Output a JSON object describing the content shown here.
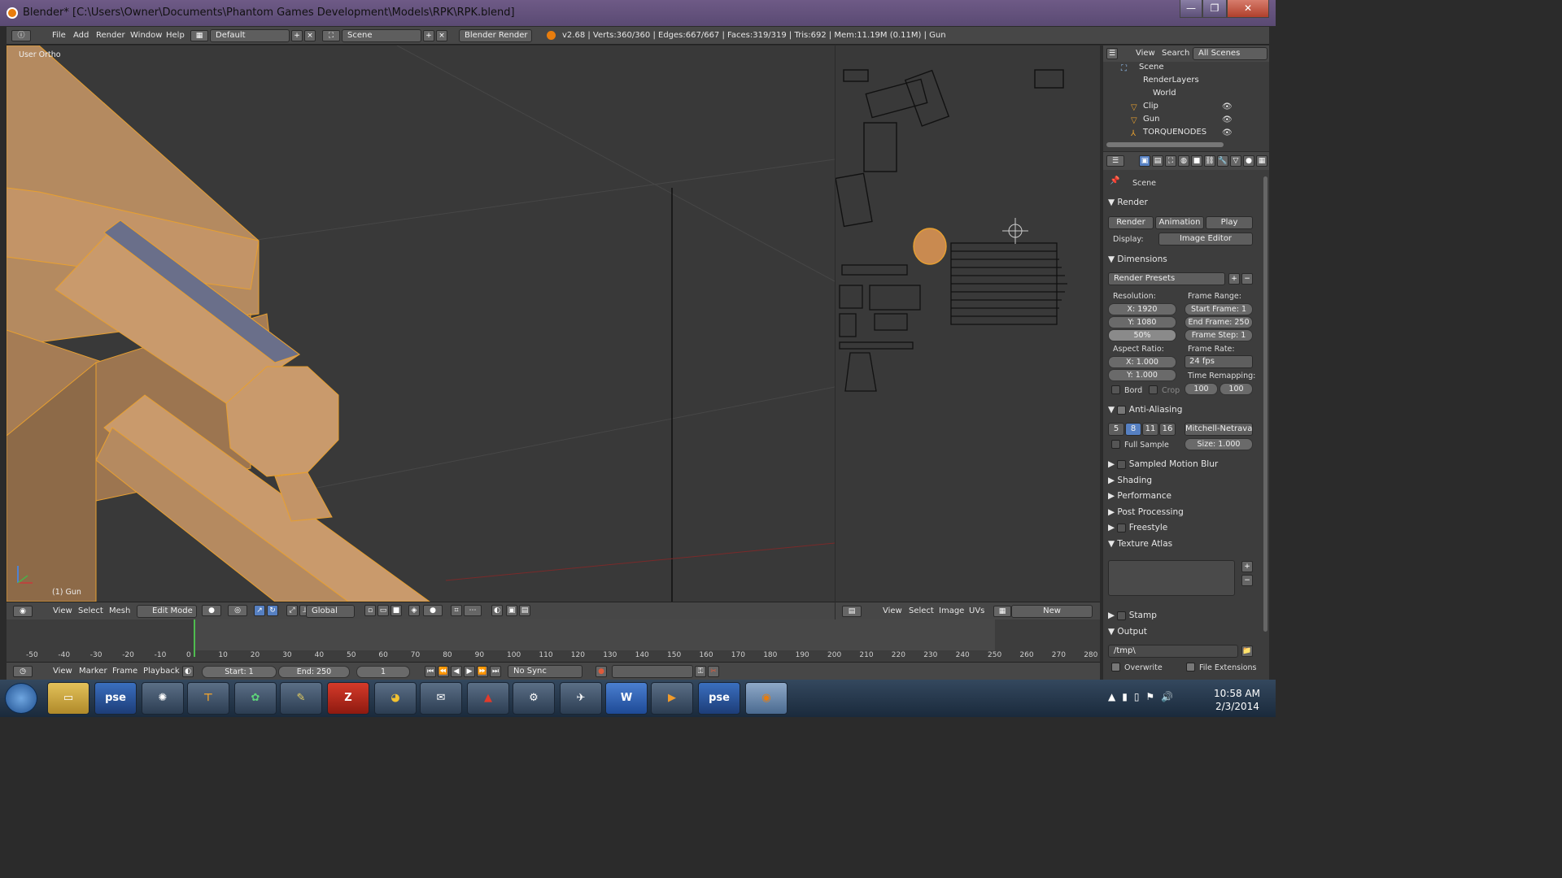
{
  "window": {
    "title": "Blender* [C:\\Users\\Owner\\Documents\\Phantom Games Development\\Models\\RPK\\RPK.blend]",
    "controls": [
      "—",
      "❐",
      "✕"
    ]
  },
  "menu": [
    "File",
    "Add",
    "Render",
    "Window",
    "Help"
  ],
  "layout": "Default",
  "scene": "Scene",
  "engine": "Blender Render",
  "stats": "v2.68 | Verts:360/360 | Edges:667/667 | Faces:319/319 | Tris:692 | Mem:11.19M (0.11M) | Gun",
  "viewport": {
    "label": "User Ortho",
    "object_label": "(1) Gun"
  },
  "vp_header": {
    "menu": [
      "View",
      "Select",
      "Mesh"
    ],
    "mode": "Edit Mode",
    "orientation": "Global"
  },
  "uv_header": {
    "menu": [
      "View",
      "Select",
      "Image",
      "UVs"
    ],
    "new_btn": "New"
  },
  "outliner": {
    "menu": [
      "View",
      "Search"
    ],
    "filter": "All Scenes",
    "items": [
      "Scene",
      "RenderLayers",
      "World",
      "Clip",
      "Gun",
      "TORQUENODES"
    ]
  },
  "props": {
    "context": "Scene",
    "render_title": "Render",
    "render_btns": [
      "Render",
      "Animation",
      "Play"
    ],
    "display_label": "Display:",
    "display_value": "Image Editor",
    "dimensions": "Dimensions",
    "presets": "Render Presets",
    "resolution_label": "Resolution:",
    "res_x": "X: 1920",
    "res_y": "Y: 1080",
    "res_pct": "50%",
    "frame_range_label": "Frame Range:",
    "start_frame": "Start Frame: 1",
    "end_frame": "End Frame: 250",
    "frame_step": "Frame Step: 1",
    "aspect_label": "Aspect Ratio:",
    "asp_x": "X: 1.000",
    "asp_y": "Y: 1.000",
    "frame_rate_label": "Frame Rate:",
    "fps": "24 fps",
    "time_remap_label": "Time Remapping:",
    "remap_old": "100",
    "remap_new": "100",
    "bord": "Bord",
    "crop": "Crop",
    "aa": "Anti-Aliasing",
    "aa_samples": [
      "5",
      "8",
      "11",
      "16"
    ],
    "aa_filter": "Mitchell-Netraval",
    "full_sample": "Full Sample",
    "aa_size": "Size: 1.000",
    "panels": [
      "Sampled Motion Blur",
      "Shading",
      "Performance",
      "Post Processing",
      "Freestyle",
      "Texture Atlas"
    ],
    "stamp": "Stamp",
    "output": "Output",
    "output_path": "/tmp\\",
    "overwrite": "Overwrite",
    "file_ext": "File Extensions"
  },
  "timeline": {
    "ticks": [
      "-50",
      "-40",
      "-30",
      "-20",
      "-10",
      "0",
      "10",
      "20",
      "30",
      "40",
      "50",
      "60",
      "70",
      "80",
      "90",
      "100",
      "110",
      "120",
      "130",
      "140",
      "150",
      "160",
      "170",
      "180",
      "190",
      "200",
      "210",
      "220",
      "230",
      "240",
      "250",
      "260",
      "270",
      "280"
    ],
    "current_frame": "0"
  },
  "tl_header": {
    "menu": [
      "View",
      "Marker",
      "Frame",
      "Playback"
    ],
    "start": "Start: 1",
    "end": "End: 250",
    "frame": "1",
    "sync": "No Sync"
  },
  "taskbar": {
    "apps": [
      "pse",
      "pse"
    ],
    "time": "10:58 AM",
    "date": "2/3/2014"
  },
  "colors": {
    "accent": "#e8a030",
    "mesh": "#c99a6c",
    "select": "#5680c2"
  }
}
